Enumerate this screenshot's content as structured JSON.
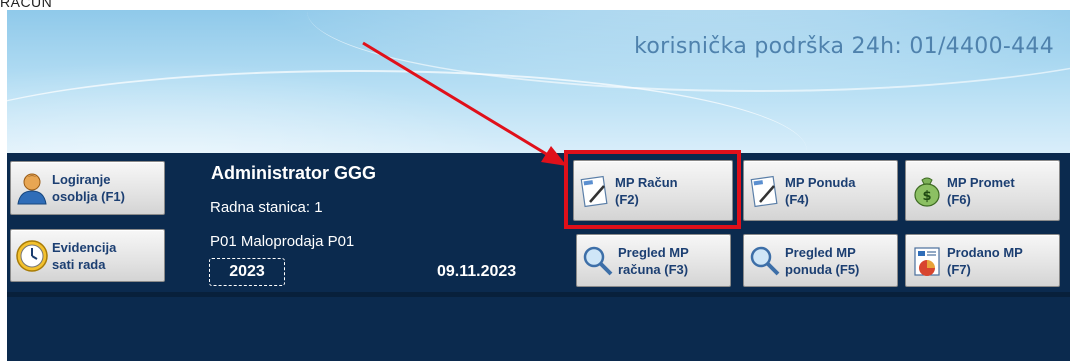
{
  "header_label": "RACUN",
  "banner": {
    "support_text": "korisnička podrška 24h: 01/4400-444"
  },
  "left_buttons": [
    {
      "label": "Logiranje\nosoblja (F1)",
      "icon": "user-icon"
    },
    {
      "label": "Evidencija\nsati rada",
      "icon": "clock-icon"
    }
  ],
  "session": {
    "user": "Administrator GGG",
    "station": "Radna stanica: 1",
    "store": "P01 Maloprodaja P01",
    "year": "2023",
    "date": "09.11.2023"
  },
  "actions": [
    {
      "label": "MP Račun\n(F2)",
      "icon": "document-pen-icon"
    },
    {
      "label": "MP Ponuda\n(F4)",
      "icon": "document-pen-icon"
    },
    {
      "label": "MP Promet\n(F6)",
      "icon": "money-bag-icon"
    },
    {
      "label": "Pregled MP\nračuna (F3)",
      "icon": "magnifier-icon"
    },
    {
      "label": "Pregled MP\nponuda (F5)",
      "icon": "magnifier-icon"
    },
    {
      "label": "Prodano MP\n(F7)",
      "icon": "report-chart-icon"
    }
  ],
  "colors": {
    "navy": "#0b2a4e",
    "highlight_red": "#e0101a",
    "label_blue": "#1c3f72"
  }
}
